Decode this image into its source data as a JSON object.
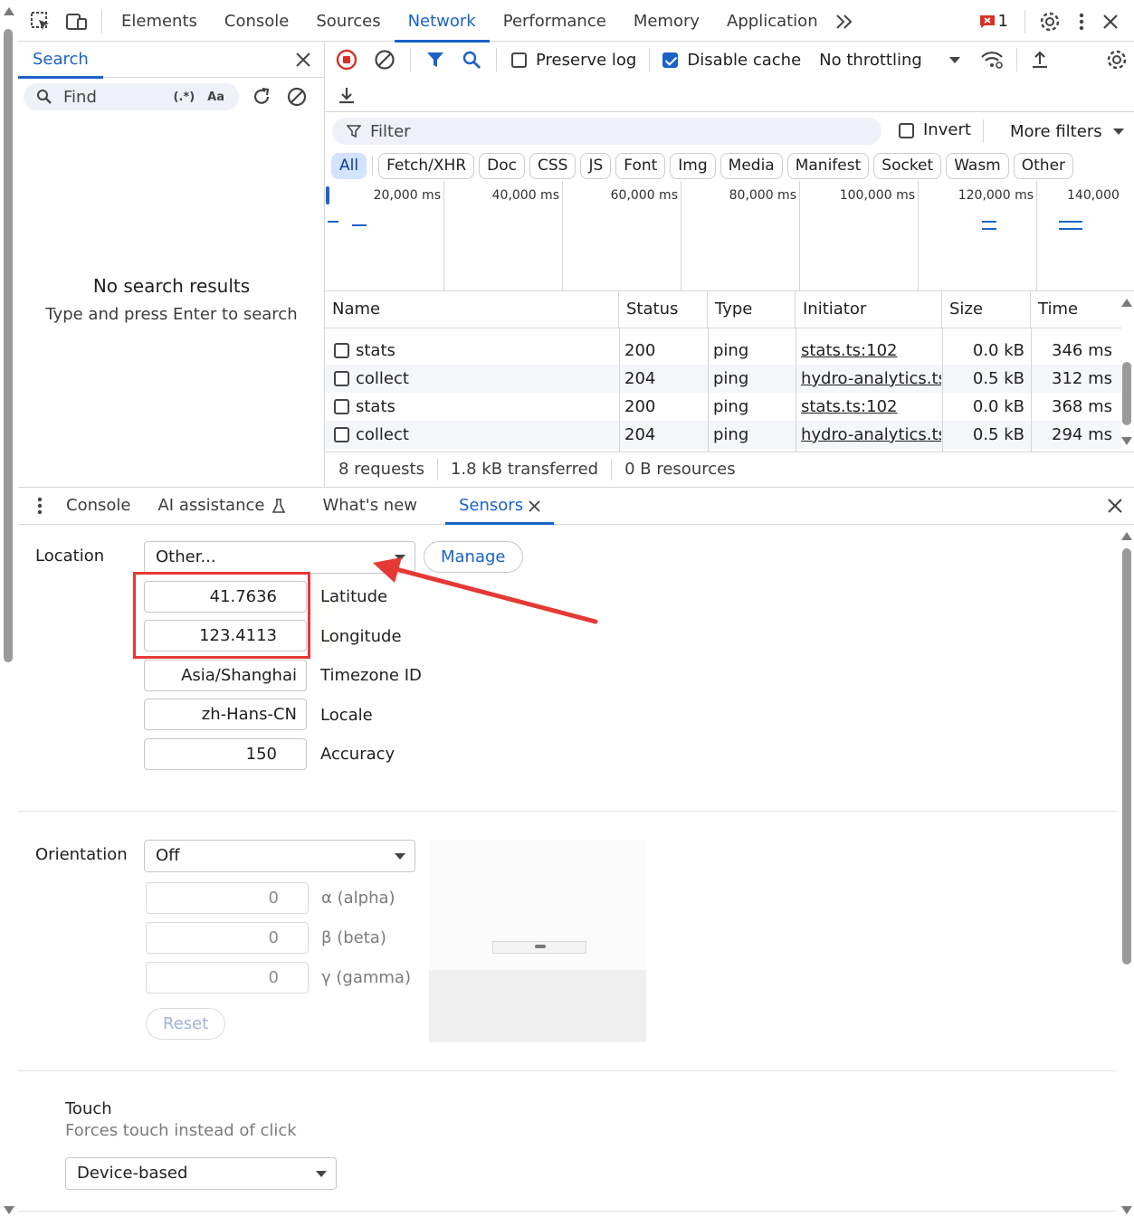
{
  "top_tabs": [
    "Elements",
    "Console",
    "Sources",
    "Network",
    "Performance",
    "Memory",
    "Application"
  ],
  "active_top_tab": "Network",
  "issues_count": "1",
  "search": {
    "tab_label": "Search",
    "find_placeholder": "Find",
    "regex_label": "(.*)",
    "case_label": "Aa",
    "empty_title": "No search results",
    "empty_hint": "Type and press Enter to search"
  },
  "network_toolbar": {
    "preserve_log_label": "Preserve log",
    "preserve_log_checked": false,
    "disable_cache_label": "Disable cache",
    "disable_cache_checked": true,
    "throttling_label": "No throttling"
  },
  "filter": {
    "placeholder": "Filter",
    "invert_label": "Invert",
    "more_filters_label": "More filters",
    "chips": [
      "All",
      "Fetch/XHR",
      "Doc",
      "CSS",
      "JS",
      "Font",
      "Img",
      "Media",
      "Manifest",
      "Socket",
      "Wasm",
      "Other"
    ],
    "active_chip": "All"
  },
  "overview": {
    "ticks": [
      "20,000 ms",
      "40,000 ms",
      "60,000 ms",
      "80,000 ms",
      "100,000 ms",
      "120,000 ms",
      "140,000"
    ]
  },
  "table": {
    "columns": [
      "Name",
      "Status",
      "Type",
      "Initiator",
      "Size",
      "Time"
    ],
    "rows": [
      {
        "name": "stats",
        "status": "200",
        "type": "ping",
        "initiator": "stats.ts:102",
        "size": "0.0 kB",
        "time": "346 ms"
      },
      {
        "name": "collect",
        "status": "204",
        "type": "ping",
        "initiator": "hydro-analytics.ts:",
        "size": "0.5 kB",
        "time": "312 ms"
      },
      {
        "name": "stats",
        "status": "200",
        "type": "ping",
        "initiator": "stats.ts:102",
        "size": "0.0 kB",
        "time": "368 ms"
      },
      {
        "name": "collect",
        "status": "204",
        "type": "ping",
        "initiator": "hydro-analytics.ts:",
        "size": "0.5 kB",
        "time": "294 ms"
      }
    ]
  },
  "status_bar": {
    "requests": "8 requests",
    "transferred": "1.8 kB transferred",
    "resources": "0 B resources"
  },
  "drawer_tabs": [
    "Console",
    "AI assistance",
    "What's new",
    "Sensors"
  ],
  "active_drawer_tab": "Sensors",
  "sensors": {
    "location_label": "Location",
    "location_value": "Other...",
    "manage_label": "Manage",
    "latitude": "41.7636",
    "latitude_label": "Latitude",
    "longitude": "123.4113",
    "longitude_label": "Longitude",
    "timezone": "Asia/Shanghai",
    "timezone_label": "Timezone ID",
    "locale": "zh-Hans-CN",
    "locale_label": "Locale",
    "accuracy": "150",
    "accuracy_label": "Accuracy",
    "orientation_label": "Orientation",
    "orientation_value": "Off",
    "alpha": "0",
    "alpha_label": "α (alpha)",
    "beta": "0",
    "beta_label": "β (beta)",
    "gamma": "0",
    "gamma_label": "γ (gamma)",
    "reset_label": "Reset",
    "touch_title": "Touch",
    "touch_hint": "Forces touch instead of click",
    "touch_value": "Device-based"
  },
  "colors": {
    "accent": "#1a62c9",
    "record": "#d93025",
    "annotation": "#e53935"
  }
}
